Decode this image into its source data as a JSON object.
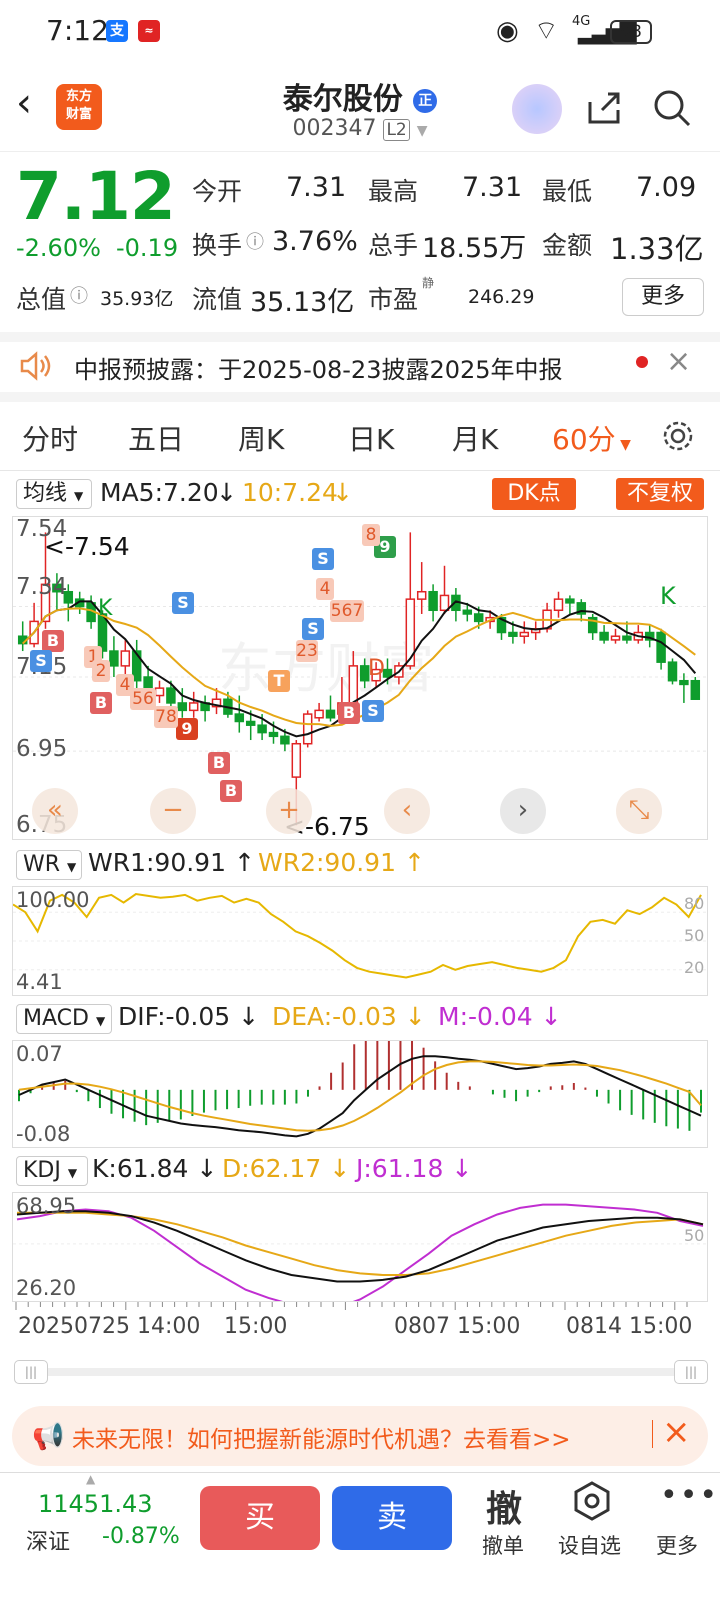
{
  "status_bar": {
    "time": "7:12",
    "battery": "98",
    "network": "4G"
  },
  "header": {
    "logo_text": "东方\n财富",
    "stock_name": "泰尔股份",
    "badge": "正",
    "stock_code": "002347",
    "level": "L2"
  },
  "quote": {
    "price": "7.12",
    "change_pct": "-2.60%",
    "change": "-0.19",
    "open_label": "今开",
    "open": "7.31",
    "high_label": "最高",
    "high": "7.31",
    "low_label": "最低",
    "low": "7.09",
    "turnover_label": "换手",
    "turnover": "3.76%",
    "volume_label": "总手",
    "volume": "18.55万",
    "amount_label": "金额",
    "amount": "1.33亿",
    "mktcap_label": "总值",
    "mktcap": "35.93亿",
    "float_label": "流值",
    "float_cap": "35.13亿",
    "pe_label": "市盈",
    "pe_sup": "静",
    "pe": "246.29",
    "more_label": "更多"
  },
  "notice": {
    "text": "中报预披露：于2025-08-23披露2025年中报"
  },
  "tabs": [
    "分时",
    "五日",
    "周K",
    "日K",
    "月K",
    "60分"
  ],
  "active_tab": "60分",
  "ma_bar": {
    "selector": "均线",
    "ma5": "MA5:7.20",
    "ma10": "10:7.24",
    "dk_btn": "DK点",
    "adj_btn": "不复权"
  },
  "kline": {
    "y_labels": [
      "7.54",
      "7.34",
      "7.15",
      "6.95",
      "6.75"
    ],
    "max_marker": "<-7.54",
    "min_marker": "<-6.75",
    "watermark": "东方财富",
    "candles": [
      {
        "o": 7.26,
        "c": 7.24,
        "h": 7.3,
        "l": 7.22
      },
      {
        "o": 7.24,
        "c": 7.3,
        "h": 7.35,
        "l": 7.23
      },
      {
        "o": 7.3,
        "c": 7.4,
        "h": 7.54,
        "l": 7.28
      },
      {
        "o": 7.4,
        "c": 7.38,
        "h": 7.43,
        "l": 7.33
      },
      {
        "o": 7.38,
        "c": 7.35,
        "h": 7.4,
        "l": 7.3
      },
      {
        "o": 7.36,
        "c": 7.34,
        "h": 7.38,
        "l": 7.32
      },
      {
        "o": 7.35,
        "c": 7.3,
        "h": 7.37,
        "l": 7.28
      },
      {
        "o": 7.32,
        "c": 7.22,
        "h": 7.33,
        "l": 7.2
      },
      {
        "o": 7.22,
        "c": 7.18,
        "h": 7.26,
        "l": 7.15
      },
      {
        "o": 7.18,
        "c": 7.22,
        "h": 7.25,
        "l": 7.15
      },
      {
        "o": 7.22,
        "c": 7.14,
        "h": 7.25,
        "l": 7.12
      },
      {
        "o": 7.15,
        "c": 7.1,
        "h": 7.18,
        "l": 7.08
      },
      {
        "o": 7.1,
        "c": 7.12,
        "h": 7.14,
        "l": 7.08
      },
      {
        "o": 7.12,
        "c": 7.08,
        "h": 7.14,
        "l": 7.05
      },
      {
        "o": 7.08,
        "c": 7.06,
        "h": 7.12,
        "l": 7.04
      },
      {
        "o": 7.06,
        "c": 7.08,
        "h": 7.11,
        "l": 7.04
      },
      {
        "o": 7.08,
        "c": 7.06,
        "h": 7.1,
        "l": 7.03
      },
      {
        "o": 7.07,
        "c": 7.09,
        "h": 7.12,
        "l": 7.05
      },
      {
        "o": 7.09,
        "c": 7.05,
        "h": 7.11,
        "l": 7.04
      },
      {
        "o": 7.05,
        "c": 7.03,
        "h": 7.1,
        "l": 7.0
      },
      {
        "o": 7.03,
        "c": 7.02,
        "h": 7.06,
        "l": 6.98
      },
      {
        "o": 7.02,
        "c": 7.0,
        "h": 7.05,
        "l": 6.98
      },
      {
        "o": 7.0,
        "c": 6.99,
        "h": 7.03,
        "l": 6.97
      },
      {
        "o": 6.99,
        "c": 6.97,
        "h": 7.01,
        "l": 6.95
      },
      {
        "o": 6.88,
        "c": 6.97,
        "h": 6.98,
        "l": 6.75
      },
      {
        "o": 6.97,
        "c": 7.05,
        "h": 7.06,
        "l": 6.96
      },
      {
        "o": 7.04,
        "c": 7.06,
        "h": 7.08,
        "l": 7.03
      },
      {
        "o": 7.06,
        "c": 7.04,
        "h": 7.1,
        "l": 7.03
      },
      {
        "o": 7.05,
        "c": 7.08,
        "h": 7.15,
        "l": 7.04
      },
      {
        "o": 7.08,
        "c": 7.18,
        "h": 7.22,
        "l": 7.06
      },
      {
        "o": 7.18,
        "c": 7.14,
        "h": 7.2,
        "l": 7.12
      },
      {
        "o": 7.14,
        "c": 7.17,
        "h": 7.19,
        "l": 7.12
      },
      {
        "o": 7.17,
        "c": 7.15,
        "h": 7.2,
        "l": 7.13
      },
      {
        "o": 7.15,
        "c": 7.18,
        "h": 7.19,
        "l": 7.13
      },
      {
        "o": 7.18,
        "c": 7.36,
        "h": 7.54,
        "l": 7.17
      },
      {
        "o": 7.36,
        "c": 7.38,
        "h": 7.46,
        "l": 7.32
      },
      {
        "o": 7.38,
        "c": 7.33,
        "h": 7.4,
        "l": 7.3
      },
      {
        "o": 7.33,
        "c": 7.37,
        "h": 7.45,
        "l": 7.32
      },
      {
        "o": 7.37,
        "c": 7.33,
        "h": 7.39,
        "l": 7.3
      },
      {
        "o": 7.33,
        "c": 7.32,
        "h": 7.35,
        "l": 7.3
      },
      {
        "o": 7.32,
        "c": 7.3,
        "h": 7.34,
        "l": 7.28
      },
      {
        "o": 7.3,
        "c": 7.31,
        "h": 7.33,
        "l": 7.28
      },
      {
        "o": 7.31,
        "c": 7.27,
        "h": 7.32,
        "l": 7.25
      },
      {
        "o": 7.27,
        "c": 7.26,
        "h": 7.3,
        "l": 7.24
      },
      {
        "o": 7.26,
        "c": 7.27,
        "h": 7.3,
        "l": 7.24
      },
      {
        "o": 7.27,
        "c": 7.28,
        "h": 7.3,
        "l": 7.25
      },
      {
        "o": 7.28,
        "c": 7.33,
        "h": 7.35,
        "l": 7.27
      },
      {
        "o": 7.33,
        "c": 7.36,
        "h": 7.38,
        "l": 7.31
      },
      {
        "o": 7.36,
        "c": 7.35,
        "h": 7.37,
        "l": 7.32
      },
      {
        "o": 7.35,
        "c": 7.32,
        "h": 7.36,
        "l": 7.3
      },
      {
        "o": 7.31,
        "c": 7.27,
        "h": 7.32,
        "l": 7.25
      },
      {
        "o": 7.27,
        "c": 7.25,
        "h": 7.29,
        "l": 7.24
      },
      {
        "o": 7.25,
        "c": 7.26,
        "h": 7.28,
        "l": 7.24
      },
      {
        "o": 7.26,
        "c": 7.25,
        "h": 7.3,
        "l": 7.24
      },
      {
        "o": 7.25,
        "c": 7.27,
        "h": 7.29,
        "l": 7.24
      },
      {
        "o": 7.27,
        "c": 7.25,
        "h": 7.29,
        "l": 7.23
      },
      {
        "o": 7.27,
        "c": 7.19,
        "h": 7.28,
        "l": 7.17
      },
      {
        "o": 7.19,
        "c": 7.14,
        "h": 7.2,
        "l": 7.13
      },
      {
        "o": 7.14,
        "c": 7.13,
        "h": 7.16,
        "l": 7.08
      },
      {
        "o": 7.14,
        "c": 7.09,
        "h": 7.15,
        "l": 7.09
      }
    ]
  },
  "chart_controls": [
    "«",
    "−",
    "+",
    "‹",
    "›",
    "⤡"
  ],
  "wr": {
    "selector": "WR",
    "wr1": "WR1:90.91",
    "wr2": "WR2:90.91",
    "y_top": "100.00",
    "y_bot": "4.41",
    "r_labels": [
      "80",
      "50",
      "20"
    ],
    "values": [
      88,
      80,
      60,
      92,
      98,
      90,
      75,
      95,
      98,
      90,
      99,
      97,
      95,
      96,
      98,
      92,
      95,
      97,
      90,
      94,
      90,
      78,
      70,
      60,
      55,
      48,
      40,
      30,
      22,
      18,
      16,
      14,
      12,
      15,
      18,
      25,
      20,
      24,
      26,
      28,
      25,
      22,
      20,
      18,
      22,
      30,
      55,
      70,
      72,
      68,
      82,
      78,
      85,
      95,
      88,
      75,
      98
    ]
  },
  "macd": {
    "selector": "MACD",
    "dif": "DIF:-0.05",
    "dea": "DEA:-0.03",
    "m": "M:-0.04",
    "y_top": "0.07",
    "y_bot": "-0.08",
    "dif_values": [
      -0.01,
      0.0,
      0.01,
      0.015,
      0.02,
      0.01,
      0.0,
      -0.01,
      -0.02,
      -0.03,
      -0.04,
      -0.05,
      -0.055,
      -0.06,
      -0.065,
      -0.068,
      -0.07,
      -0.072,
      -0.075,
      -0.078,
      -0.08,
      -0.082,
      -0.085,
      -0.088,
      -0.09,
      -0.085,
      -0.075,
      -0.06,
      -0.045,
      -0.02,
      0.0,
      0.02,
      0.035,
      0.05,
      0.06,
      0.065,
      0.065,
      0.063,
      0.06,
      0.058,
      0.055,
      0.05,
      0.045,
      0.04,
      0.042,
      0.045,
      0.05,
      0.052,
      0.055,
      0.05,
      0.04,
      0.03,
      0.02,
      0.01,
      0.0,
      -0.01,
      -0.02,
      -0.03,
      -0.04,
      -0.05
    ],
    "dea_values": [
      0.0,
      0.003,
      0.006,
      0.009,
      0.012,
      0.012,
      0.01,
      0.006,
      0.001,
      -0.005,
      -0.012,
      -0.019,
      -0.026,
      -0.033,
      -0.039,
      -0.045,
      -0.05,
      -0.054,
      -0.058,
      -0.062,
      -0.066,
      -0.069,
      -0.072,
      -0.075,
      -0.078,
      -0.079,
      -0.078,
      -0.075,
      -0.069,
      -0.06,
      -0.048,
      -0.035,
      -0.02,
      -0.005,
      0.012,
      0.028,
      0.04,
      0.048,
      0.053,
      0.055,
      0.055,
      0.054,
      0.052,
      0.05,
      0.048,
      0.047,
      0.047,
      0.048,
      0.049,
      0.048,
      0.046,
      0.042,
      0.038,
      0.032,
      0.026,
      0.019,
      0.012,
      0.004,
      -0.004,
      -0.03
    ]
  },
  "kdj": {
    "selector": "KDJ",
    "k": "K:61.84",
    "d": "D:62.17",
    "j": "J:61.18",
    "y_top": "68.95",
    "y_bot": "26.20",
    "r_label": "50",
    "k_values": [
      68,
      69,
      70,
      70,
      69,
      67,
      63,
      58,
      52,
      46,
      40,
      35,
      31,
      29,
      27,
      27,
      28,
      30,
      34,
      40,
      46,
      52,
      56,
      60,
      62,
      64,
      65,
      66,
      66,
      65,
      62
    ],
    "d_values": [
      69,
      69,
      69,
      69,
      68,
      67,
      65,
      62,
      58,
      54,
      49,
      45,
      41,
      37,
      34,
      32,
      31,
      31,
      32,
      35,
      39,
      43,
      47,
      51,
      55,
      58,
      61,
      63,
      64,
      65,
      62
    ],
    "j_values": [
      65,
      67,
      70,
      71,
      70,
      66,
      58,
      48,
      38,
      30,
      22,
      17,
      13,
      12,
      11,
      16,
      24,
      34,
      44,
      55,
      62,
      68,
      72,
      74,
      74,
      73,
      72,
      71,
      69,
      64,
      61
    ]
  },
  "x_labels": [
    "20250725 14:00",
    "15:00",
    "0807 15:00",
    "0814 15:00"
  ],
  "promo": {
    "text": "未来无限！如何把握新能源时代机遇？去看看>>"
  },
  "bottom": {
    "index_value": "11451.43",
    "index_name": "深证",
    "index_change": "-0.87%",
    "buy": "买",
    "sell": "卖",
    "cancel_icon_char": "撤",
    "cancel_label": "撤单",
    "watch_label": "设自选",
    "more_label": "更多"
  },
  "colors": {
    "up": "#e02424",
    "down": "#0f9d2d",
    "ma10": "#e6a817",
    "accent": "#f25b1c",
    "sell_btn": "#2f6be8"
  }
}
